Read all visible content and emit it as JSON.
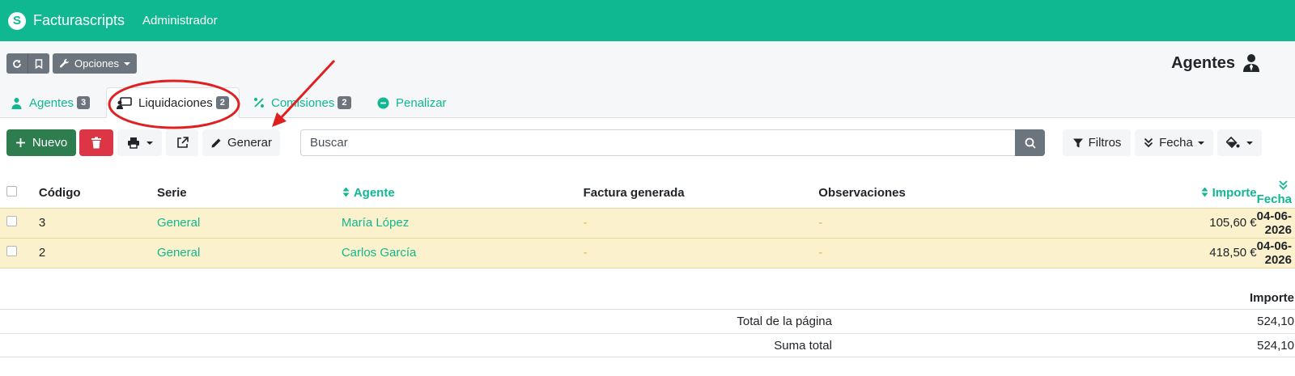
{
  "app": {
    "brand": "Facturascripts",
    "user": "Administrador"
  },
  "toolbar": {
    "options_label": "Opciones",
    "page_title": "Agentes"
  },
  "tabs": [
    {
      "label": "Agentes",
      "count": "3"
    },
    {
      "label": "Liquidaciones",
      "count": "2"
    },
    {
      "label": "Comisiones",
      "count": "2"
    },
    {
      "label": "Penalizar"
    }
  ],
  "actions": {
    "new_label": "Nuevo",
    "generate_label": "Generar",
    "filters_label": "Filtros",
    "date_label": "Fecha"
  },
  "search": {
    "placeholder": "Buscar"
  },
  "table": {
    "headers": {
      "code": "Código",
      "series": "Serie",
      "agent": "Agente",
      "invoice": "Factura generada",
      "notes": "Observaciones",
      "amount": "Importe",
      "date": "Fecha"
    },
    "rows": [
      {
        "code": "3",
        "series": "General",
        "agent": "María López",
        "invoice": "-",
        "notes": "-",
        "amount": "105,60 €",
        "date": "04-06-2026"
      },
      {
        "code": "2",
        "series": "General",
        "agent": "Carlos García",
        "invoice": "-",
        "notes": "-",
        "amount": "418,50 €",
        "date": "04-06-2026"
      }
    ]
  },
  "totals": {
    "header": "Importe",
    "rows": [
      {
        "label": "Total de la página",
        "value": "524,10"
      },
      {
        "label": "Suma total",
        "value": "524,10"
      }
    ]
  },
  "colors": {
    "brand": "#10b891",
    "row_highlight": "#fcf1cd",
    "annotation": "#e02020"
  }
}
